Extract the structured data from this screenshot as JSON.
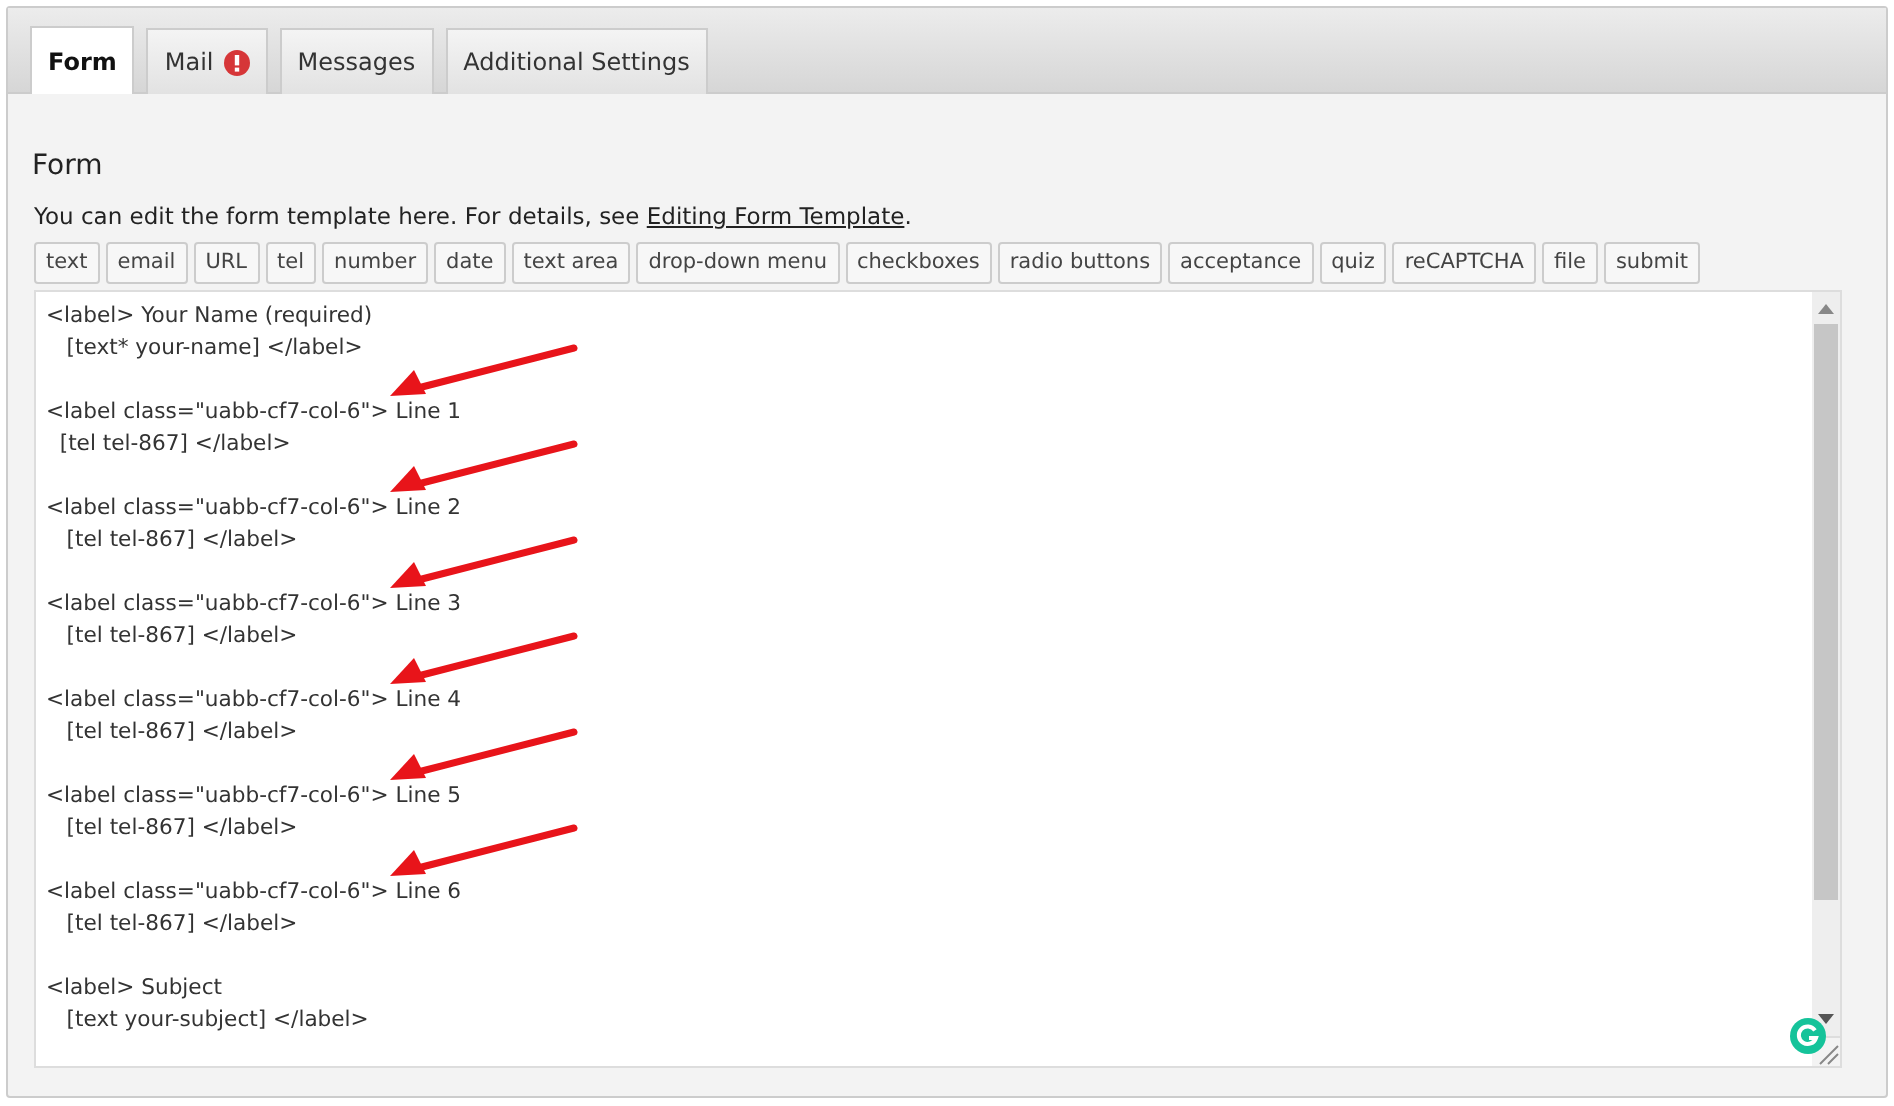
{
  "tabs": [
    {
      "label": "Form",
      "selected": true,
      "alert": false
    },
    {
      "label": "Mail",
      "selected": false,
      "alert": true
    },
    {
      "label": "Messages",
      "selected": false,
      "alert": false
    },
    {
      "label": "Additional Settings",
      "selected": false,
      "alert": false
    }
  ],
  "heading": "Form",
  "description": {
    "text": "You can edit the form template here. For details, see ",
    "link": "Editing Form Template",
    "end": "."
  },
  "tag_buttons": [
    "text",
    "email",
    "URL",
    "tel",
    "number",
    "date",
    "text area",
    "drop-down menu",
    "checkboxes",
    "radio buttons",
    "acceptance",
    "quiz",
    "reCAPTCHA",
    "file",
    "submit"
  ],
  "template_blocks": [
    {
      "lines": [
        "<label> Your Name (required)",
        "   [text* your-name] </label>"
      ],
      "arrow": false
    },
    {
      "lines": [
        "<label class=\"uabb-cf7-col-6\"> Line 1",
        "  [tel tel-867] </label>"
      ],
      "arrow": true
    },
    {
      "lines": [
        "<label class=\"uabb-cf7-col-6\"> Line 2",
        "   [tel tel-867] </label>"
      ],
      "arrow": true
    },
    {
      "lines": [
        "<label class=\"uabb-cf7-col-6\"> Line 3",
        "   [tel tel-867] </label>"
      ],
      "arrow": true
    },
    {
      "lines": [
        "<label class=\"uabb-cf7-col-6\"> Line 4",
        "   [tel tel-867] </label>"
      ],
      "arrow": true
    },
    {
      "lines": [
        "<label class=\"uabb-cf7-col-6\"> Line 5",
        "   [tel tel-867] </label>"
      ],
      "arrow": true
    },
    {
      "lines": [
        "<label class=\"uabb-cf7-col-6\"> Line 6",
        "   [tel tel-867] </label>"
      ],
      "arrow": true
    },
    {
      "lines": [
        "<label> Subject",
        "   [text your-subject] </label>"
      ],
      "arrow": false
    }
  ]
}
